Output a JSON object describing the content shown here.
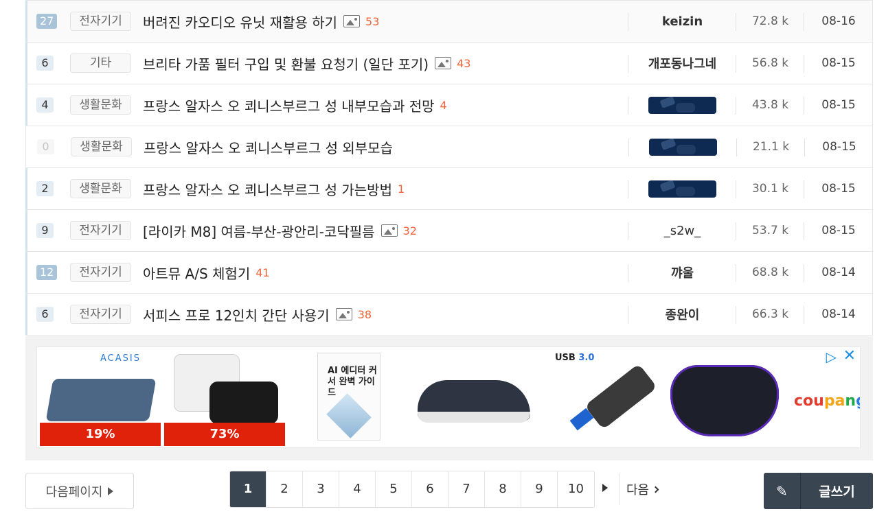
{
  "posts": [
    {
      "votes": "27",
      "category": "전자기기",
      "title": "버려진 카오디오 유닛 재활용 하기",
      "has_image": true,
      "comments": "53",
      "author": "keizin",
      "views": "72.8 k",
      "date": "08-16"
    },
    {
      "votes": "6",
      "category": "기타",
      "title": "브리타 가품 필터 구입 및 환불 요청기 (일단 포기)",
      "has_image": true,
      "comments": "43",
      "author": "개포동나그네",
      "views": "56.8 k",
      "date": "08-15"
    },
    {
      "votes": "4",
      "category": "생활문화",
      "title": "프랑스 알자스 오 쾨니스부르그 성 내부모습과 전망",
      "has_image": false,
      "comments": "4",
      "author_image": true,
      "views": "43.8 k",
      "date": "08-15"
    },
    {
      "votes": "0",
      "category": "생활문화",
      "title": "프랑스 알자스 오 쾨니스부르그 성 외부모습",
      "has_image": false,
      "comments": "",
      "author_image": true,
      "views": "21.1 k",
      "date": "08-15"
    },
    {
      "votes": "2",
      "category": "생활문화",
      "title": "프랑스 알자스 오 쾨니스부르그 성 가는방법",
      "has_image": false,
      "comments": "1",
      "author_image": true,
      "views": "30.1 k",
      "date": "08-15"
    },
    {
      "votes": "9",
      "category": "전자기기",
      "title": "[라이카 M8] 여름-부산-광안리-코닥필름",
      "has_image": true,
      "comments": "32",
      "author": "_s2w_",
      "views": "53.7 k",
      "date": "08-15"
    },
    {
      "votes": "12",
      "category": "전자기기",
      "title": "아트뮤 A/S 체험기",
      "has_image": false,
      "comments": "41",
      "author": "꺄울",
      "views": "68.8 k",
      "date": "08-14"
    },
    {
      "votes": "6",
      "category": "전자기기",
      "title": "서피스 프로 12인치 간단 사용기",
      "has_image": true,
      "comments": "38",
      "author": "종완이",
      "views": "66.3 k",
      "date": "08-14"
    }
  ],
  "ad": {
    "brand1": "ACASIS",
    "discount1": "19%",
    "discount2": "73%",
    "book_title": "AI 에디터 커서 완벽 가이드",
    "usb_label": "USB",
    "usb_version": "3.0",
    "coupang": [
      "cou",
      "pa",
      "n",
      "g"
    ]
  },
  "pagination": {
    "next_page_label": "다음페이지",
    "pages": [
      "1",
      "2",
      "3",
      "4",
      "5",
      "6",
      "7",
      "8",
      "9",
      "10"
    ],
    "current": "1",
    "next_label": "다음"
  },
  "write_label": "글쓰기",
  "colors": {
    "accent": "#3a4552",
    "comment": "#f0643a",
    "vote_hi": "#a9c3d9",
    "discount": "#e0220a"
  }
}
